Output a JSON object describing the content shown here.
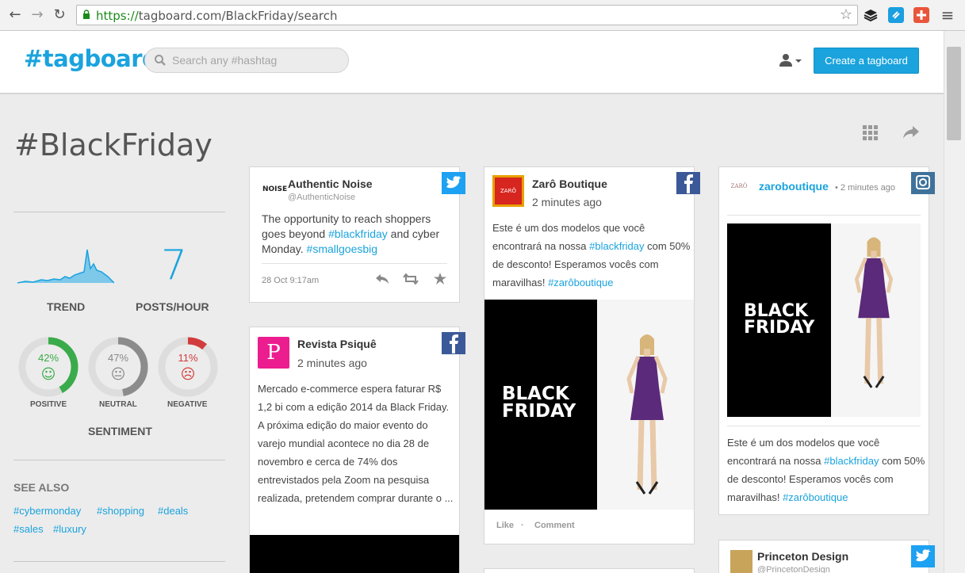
{
  "browser": {
    "url_scheme": "https://",
    "url_host": "tagboard.com",
    "url_path": "/BlackFriday/search",
    "back_glyph": "←",
    "forward_glyph": "→",
    "reload_glyph": "↻",
    "star_glyph": "☆",
    "menu_glyph": "≡"
  },
  "header": {
    "logo": "#tagboard",
    "search_placeholder": "Search any #hashtag",
    "create_button": "Create a tagboard"
  },
  "page": {
    "title": "#BlackFriday"
  },
  "stats": {
    "posts_per_hour": "7",
    "trend_label": "TREND",
    "posts_label": "POSTS/HOUR",
    "sentiment_label": "SENTIMENT",
    "sentiment": [
      {
        "label": "POSITIVE",
        "pct_text": "42%",
        "pct": 0.42,
        "face": "☺",
        "color": "#3aab4a"
      },
      {
        "label": "NEUTRAL",
        "pct_text": "47%",
        "pct": 0.47,
        "face": "😐",
        "color": "#8c8c8c"
      },
      {
        "label": "NEGATIVE",
        "pct_text": "11%",
        "pct": 0.11,
        "face": "☹",
        "color": "#d23c3c"
      }
    ]
  },
  "see_also": {
    "label": "SEE ALSO",
    "tags": [
      "#cybermonday",
      "#shopping",
      "#deals",
      "#sales",
      "#luxury"
    ]
  },
  "posts": {
    "p1": {
      "author": "Authentic Noise",
      "handle": "@AuthenticNoise",
      "avatar_text": "NOISE",
      "text_a": "The opportunity to reach shoppers goes beyond ",
      "link_a": "#blackfriday",
      "text_b": " and cyber Monday. ",
      "link_b": "#smallgoesbig",
      "time": "28 Oct 9:17am"
    },
    "p2": {
      "author": "Revista Psiquê",
      "time": "2 minutes ago",
      "avatar_text": "P",
      "text": "Mercado e-commerce espera faturar R$ 1,2 bi com a edição 2014 da Black Friday. A próxima edição do maior evento do varejo mundial acontece no dia 28 de novembro e cerca de 74% dos entrevistados pela Zoom na pesquisa realizada, pretendem comprar durante o ..."
    },
    "p3": {
      "author": "Zarô Boutique",
      "time": "2 minutes ago",
      "avatar_text": "ZARÔ",
      "text_a": "Este é um dos modelos que você encontrará na nossa ",
      "link_a": "#blackfriday",
      "text_b": " com 50% de desconto! Esperamos vocês com maravilhas! ",
      "link_b": "#zarôboutique",
      "image_text_1": "BLACK",
      "image_text_2": "FRIDAY",
      "like": "Like",
      "comment": "Comment",
      "sep": "·"
    },
    "p4": {
      "author": "zaroboutique",
      "time": "• 2 minutes ago",
      "avatar_text": "ZARÔ",
      "text_a": "Este é um dos modelos que você encontrará na nossa ",
      "link_a": "#blackfriday",
      "text_b": " com 50% de desconto! Esperamos vocês com maravilhas! ",
      "link_b": "#zarôboutique",
      "image_text_1": "BLACK",
      "image_text_2": "FRIDAY"
    },
    "p5": {
      "author": "Princeton Design",
      "handle": "@PrincetonDesign"
    }
  },
  "colors": {
    "accent": "#1aa3dd",
    "twitter": "#1da1f2",
    "facebook": "#3b5998",
    "instagram": "#3f729b"
  }
}
